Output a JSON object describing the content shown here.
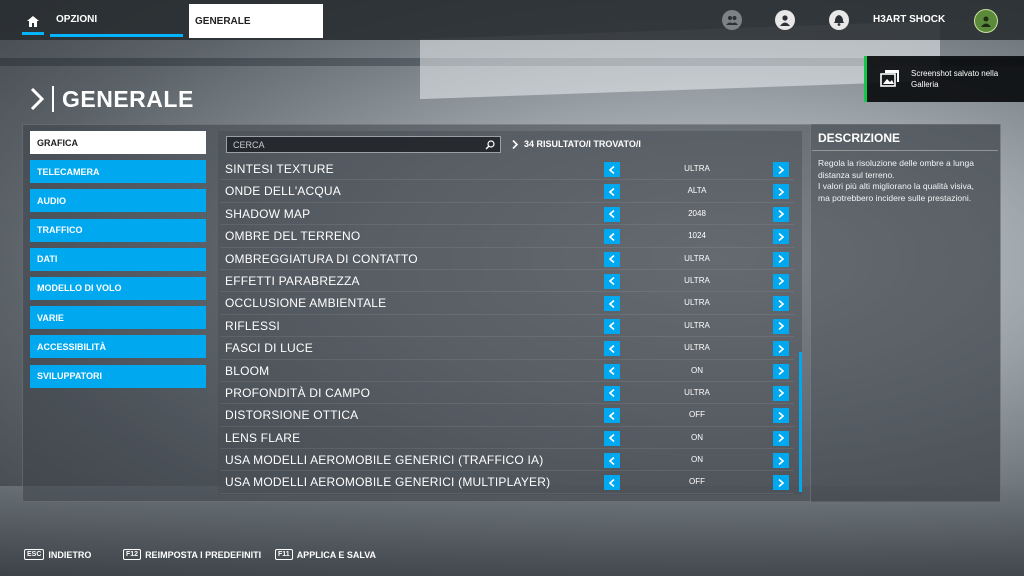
{
  "topbar": {
    "home_icon": "home-icon",
    "tab_opzioni": "OPZIONI",
    "tab_generale": "GENERALE",
    "friends_icon": "friends-icon",
    "profile_icon": "profile-icon",
    "notifications_icon": "bell-icon",
    "username": "H3ART SHOCK",
    "avatar_icon": "avatar-icon"
  },
  "notification": {
    "icon": "screenshot-gallery-icon",
    "text": "Screenshot salvato nella Galleria",
    "accent": "#12c84a"
  },
  "page": {
    "title": "GENERALE"
  },
  "menu": {
    "items": [
      {
        "label": "GRAFICA",
        "active": true
      },
      {
        "label": "TELECAMERA"
      },
      {
        "label": "AUDIO"
      },
      {
        "label": "TRAFFICO"
      },
      {
        "label": "DATI"
      },
      {
        "label": "MODELLO DI VOLO"
      },
      {
        "label": "VARIE"
      },
      {
        "label": "ACCESSIBILITÀ"
      },
      {
        "label": "SVILUPPATORI"
      }
    ]
  },
  "search": {
    "placeholder": "CERCA",
    "value": ""
  },
  "results": {
    "text": "34 RISULTATO/I TROVATO/I"
  },
  "settings": [
    {
      "label": "SINTESI TEXTURE",
      "value": "ULTRA"
    },
    {
      "label": "ONDE DELL'ACQUA",
      "value": "ALTA"
    },
    {
      "label": "SHADOW MAP",
      "value": "2048"
    },
    {
      "label": "OMBRE DEL TERRENO",
      "value": "1024"
    },
    {
      "label": "OMBREGGIATURA DI CONTATTO",
      "value": "ULTRA"
    },
    {
      "label": "EFFETTI PARABREZZA",
      "value": "ULTRA"
    },
    {
      "label": "OCCLUSIONE AMBIENTALE",
      "value": "ULTRA"
    },
    {
      "label": "RIFLESSI",
      "value": "ULTRA"
    },
    {
      "label": "FASCI DI LUCE",
      "value": "ULTRA"
    },
    {
      "label": "BLOOM",
      "value": "ON"
    },
    {
      "label": "PROFONDITÀ DI CAMPO",
      "value": "ULTRA"
    },
    {
      "label": "DISTORSIONE OTTICA",
      "value": "OFF"
    },
    {
      "label": "LENS FLARE",
      "value": "ON"
    },
    {
      "label": "USA MODELLI AEROMOBILE GENERICI (TRAFFICO IA)",
      "value": "ON"
    },
    {
      "label": "USA MODELLI AEROMOBILE GENERICI (MULTIPLAYER)",
      "value": "OFF"
    }
  ],
  "description": {
    "title": "DESCRIZIONE",
    "text": "Regola la risoluzione delle ombre a lunga distanza sul terreno.\nI valori più alti migliorano la qualità visiva, ma potrebbero incidere sulle prestazioni."
  },
  "footer": {
    "back": {
      "key": "ESC",
      "label": "INDIETRO"
    },
    "reset": {
      "key": "F12",
      "label": "REIMPOSTA I PREDEFINITI"
    },
    "apply": {
      "key": "F11",
      "label": "APPLICA E SALVA"
    }
  },
  "colors": {
    "accent": "#00a8f0",
    "panel": "#3c4248"
  }
}
